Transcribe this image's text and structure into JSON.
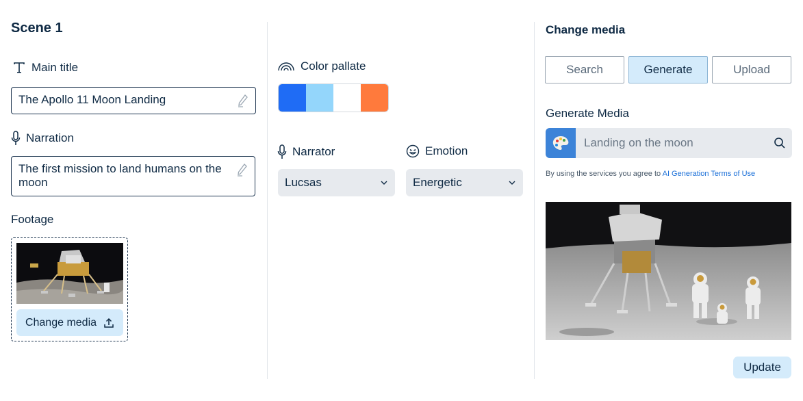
{
  "scene": {
    "title": "Scene 1"
  },
  "main_title": {
    "label": "Main title",
    "value": "The Apollo 11 Moon Landing"
  },
  "narration": {
    "label": "Narration",
    "value": "The first mission to land humans on the moon"
  },
  "footage": {
    "label": "Footage",
    "change_media_label": "Change media"
  },
  "palette": {
    "label": "Color pallate",
    "colors": [
      "#1f6cf5",
      "#94d6fb",
      "#ffffff",
      "#ff7a3c"
    ]
  },
  "narrator": {
    "label": "Narrator",
    "value": "Lucsas"
  },
  "emotion": {
    "label": "Emotion",
    "value": "Energetic"
  },
  "change_media": {
    "title": "Change media",
    "tabs": [
      {
        "label": "Search",
        "active": false
      },
      {
        "label": "Generate",
        "active": true
      },
      {
        "label": "Upload",
        "active": false
      }
    ],
    "generate_title": "Generate Media",
    "search_value": "Landing on the moon",
    "terms_prefix": "By using the services you agree to ",
    "terms_link": "AI Generation Terms of Use",
    "update_label": "Update"
  },
  "colors": {
    "text": "#0f2a44",
    "accent_light": "#d4ebfb",
    "select_bg": "#e7eaee",
    "link": "#1a6fd8"
  },
  "icons": {
    "main_title": "text-t-icon",
    "narration": "microphone-icon",
    "pencil": "pencil-icon",
    "upload": "upload-icon",
    "palette": "rainbow-icon",
    "narrator": "microphone-icon",
    "emotion": "smiley-icon",
    "chevron": "chevron-down-icon",
    "artist_palette": "artist-palette-icon",
    "search": "search-icon"
  }
}
